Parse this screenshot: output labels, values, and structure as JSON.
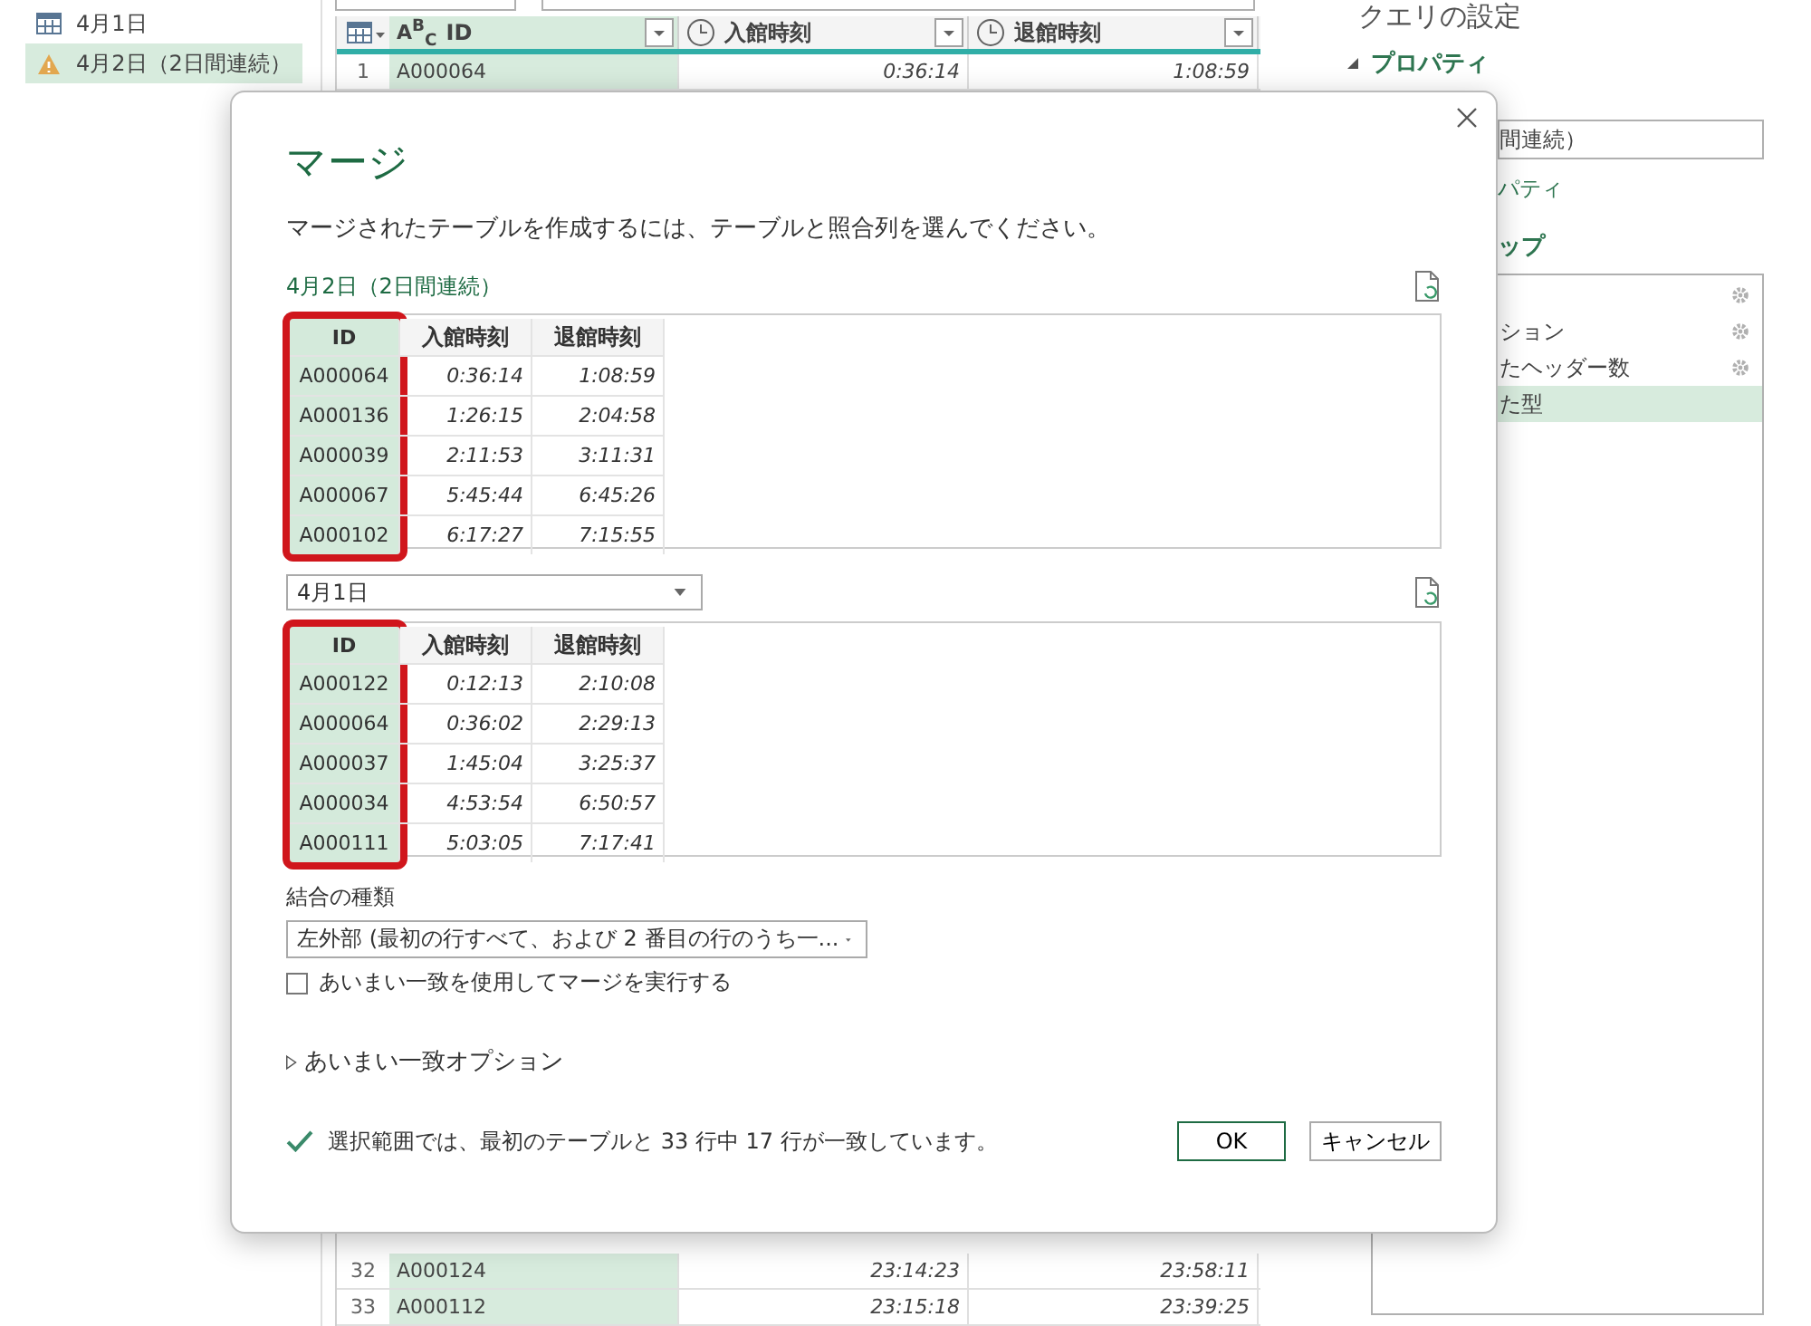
{
  "queries_panel": {
    "queries": [
      {
        "name": "4月1日",
        "kind": "table",
        "selected": false
      },
      {
        "name": "4月2日（2日間連続）",
        "kind": "warning",
        "selected": true
      }
    ]
  },
  "grid": {
    "columns": [
      {
        "name": "ID",
        "kind": "text",
        "type_label": "A$^{B}$$_{C}$"
      },
      {
        "name": "入館時刻",
        "kind": "time"
      },
      {
        "name": "退館時刻",
        "kind": "time"
      }
    ],
    "top_rows": [
      {
        "number": "1",
        "cells": [
          "A000064",
          "0:36:14",
          "1:08:59"
        ]
      }
    ],
    "bottom_rows": [
      {
        "number": "32",
        "cells": [
          "A000124",
          "23:14:23",
          "23:58:11"
        ]
      },
      {
        "number": "33",
        "cells": [
          "A000112",
          "23:15:18",
          "23:39:25"
        ]
      }
    ]
  },
  "settings_panel": {
    "title": "クエリの設定",
    "properties_heading": "プロパティ",
    "properties_expanded": true,
    "name_value": "間連続）",
    "all_properties_link": "パティ",
    "steps_heading": "ップ",
    "steps": [
      {
        "settings": true,
        "selected": false
      },
      {
        "label": "ション",
        "settings": true,
        "selected": false
      },
      {
        "label": "たヘッダー数",
        "settings": true,
        "selected": false
      },
      {
        "label": "た型",
        "settings": false,
        "selected": true
      }
    ]
  },
  "dialog": {
    "title": "マージ",
    "instruction": "マージされたテーブルを作成するには、テーブルと照合列を選んでください。",
    "first_table": {
      "name": "4月2日（2日間連続）",
      "columns": [
        {
          "name": "ID",
          "selected": true,
          "cells": [
            "A000064",
            "A000136",
            "A000039",
            "A000067",
            "A000102"
          ]
        },
        {
          "name": "入館時刻",
          "selected": false,
          "cells": [
            "0:36:14",
            "1:26:15",
            "2:11:53",
            "5:45:44",
            "6:17:27"
          ]
        },
        {
          "name": "退館時刻",
          "selected": false,
          "cells": [
            "1:08:59",
            "2:04:58",
            "3:11:31",
            "6:45:26",
            "7:15:55"
          ]
        }
      ]
    },
    "second_table": {
      "selected_table": "4月1日",
      "columns": [
        {
          "name": "ID",
          "selected": true,
          "cells": [
            "A000122",
            "A000064",
            "A000037",
            "A000034",
            "A000111"
          ]
        },
        {
          "name": "入館時刻",
          "selected": false,
          "cells": [
            "0:12:13",
            "0:36:02",
            "1:45:04",
            "4:53:54",
            "5:03:05"
          ]
        },
        {
          "name": "退館時刻",
          "selected": false,
          "cells": [
            "2:10:08",
            "2:29:13",
            "3:25:37",
            "6:50:57",
            "7:17:41"
          ]
        }
      ]
    },
    "join_kind": {
      "label": "結合の種類",
      "value": "左外部 (最初の行すべて、および 2 番目の行のうち一..."
    },
    "fuzzy_checkbox": {
      "label": "あいまい一致を使用してマージを実行する",
      "checked": false
    },
    "fuzzy_options": {
      "label": "あいまい一致オプション",
      "expanded": false
    },
    "status": {
      "text": "選択範囲では、最初のテーブルと 33 行中 17 行が一致しています。",
      "ok": true
    },
    "buttons": [
      {
        "label": "OK",
        "kind": "primary"
      },
      {
        "label": "キャンセル",
        "kind": "secondary"
      }
    ]
  }
}
